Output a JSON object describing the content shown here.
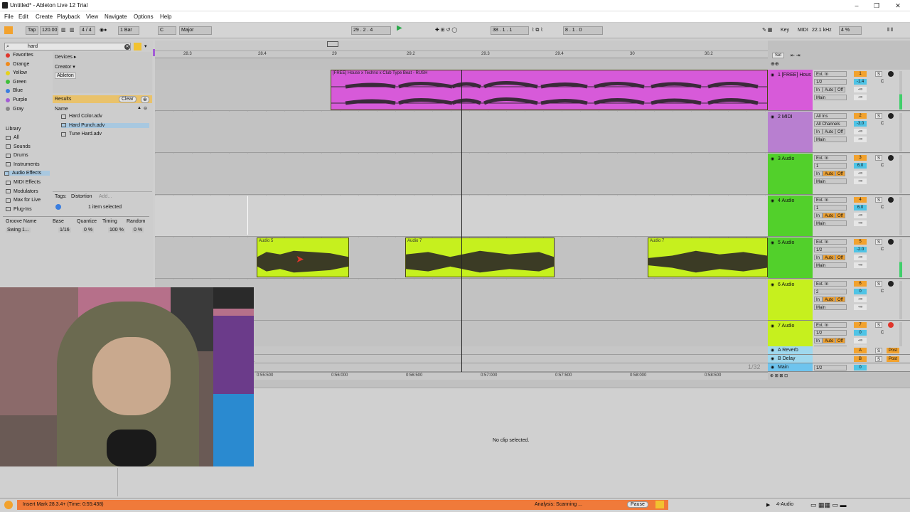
{
  "window": {
    "title": "Untitled* - Ableton Live 12 Trial"
  },
  "menu": [
    "File",
    "Edit",
    "Create",
    "Playback",
    "View",
    "Navigate",
    "Options",
    "Help"
  ],
  "control": {
    "tap": "Tap",
    "tempo": "120.00",
    "signature": "4 / 4",
    "quantize": "1 Bar",
    "key": "C",
    "scale": "Major",
    "position": "29 .  2 .  4",
    "loop_start": "38 .  1 .  1",
    "loop_length": "8 .  1 .  0",
    "key_label": "Key",
    "midi_label": "MIDI",
    "sample_rate": "22.1 kHz",
    "cpu": "4 %"
  },
  "browser": {
    "search": "hard",
    "collections": [
      {
        "label": "Favorites",
        "color": "#e0352b"
      },
      {
        "label": "Orange",
        "color": "#f08a1c"
      },
      {
        "label": "Yellow",
        "color": "#e6d21a"
      },
      {
        "label": "Green",
        "color": "#3fbf3a"
      },
      {
        "label": "Blue",
        "color": "#3a7ee0"
      },
      {
        "label": "Purple",
        "color": "#a35cd6"
      },
      {
        "label": "Gray",
        "color": "#888888"
      }
    ],
    "library_label": "Library",
    "library": [
      "All",
      "Sounds",
      "Drums",
      "Instruments",
      "Audio Effects",
      "MIDI Effects",
      "Modulators",
      "Max for Live",
      "Plug-Ins"
    ],
    "filters": {
      "devices": "Devices ▸",
      "creator": "Creator ▾",
      "ableton": "Ableton"
    },
    "results_label": "Results",
    "clear": "Clear",
    "name_header": "Name",
    "results": [
      "Hard Color.adv",
      "Hard Punch.adv",
      "Tune Hard.adv"
    ],
    "tags_label": "Tags:",
    "tag": "Distortion",
    "add": "Add...",
    "selection": "1 item selected"
  },
  "groove": {
    "headers": [
      "Groove Name",
      "Base",
      "Quantize",
      "Timing",
      "Random"
    ],
    "row": [
      "Swing 1...",
      "1/16",
      "0 %",
      "100 %",
      "0 %"
    ]
  },
  "ruler": {
    "bars": [
      "28.3",
      "28.4",
      "29",
      "29.2",
      "29.3",
      "29.4",
      "30",
      "30.2"
    ],
    "set": "Set"
  },
  "time_ruler": [
    "0:55:500",
    "0:56:000",
    "0:56:500",
    "0:57:000",
    "0:57:500",
    "0:58:000",
    "0:58:500"
  ],
  "zoom": "1/32",
  "clips": {
    "track1": "[FREE] House x Techno x Club Type Beat - RUSH",
    "a5": "Audio 5",
    "a7a": "Audio 7",
    "a7b": "Audio 7"
  },
  "tracks": [
    {
      "name": "1 [FREE] Hous",
      "num": "1",
      "in": "Ext. In",
      "ch": "1/2",
      "vol": "-1.4",
      "pan": "C",
      "out": "Main",
      "color": "#d75ad9",
      "numcolor": "#f2a22e"
    },
    {
      "name": "2 MIDI",
      "num": "2",
      "in": "All Ins",
      "ch": "All Channels",
      "vol": "-3.0",
      "pan": "C",
      "out": "Main",
      "color": "#b87fd0",
      "numcolor": "#f2a22e"
    },
    {
      "name": "3 Audio",
      "num": "3",
      "in": "Ext. In",
      "ch": "1",
      "vol": "6.0",
      "pan": "C",
      "out": "Main",
      "color": "#52d02b",
      "numcolor": "#f2a22e"
    },
    {
      "name": "4 Audio",
      "num": "4",
      "in": "Ext. In",
      "ch": "1",
      "vol": "6.0",
      "pan": "C",
      "out": "Main",
      "color": "#52d02b",
      "numcolor": "#f2a22e"
    },
    {
      "name": "5 Audio",
      "num": "5",
      "in": "Ext. In",
      "ch": "1/2",
      "vol": "-2.0",
      "pan": "C",
      "out": "Main",
      "color": "#52d02b",
      "numcolor": "#f2a22e"
    },
    {
      "name": "6 Audio",
      "num": "6",
      "in": "Ext. In",
      "ch": "2",
      "vol": "0",
      "pan": "C",
      "out": "Main",
      "color": "#c6f01e",
      "numcolor": "#f2a22e"
    },
    {
      "name": "7 Audio",
      "num": "7",
      "in": "Ext. In",
      "ch": "1/2",
      "vol": "0",
      "pan": "C",
      "out": "Main",
      "color": "#c6f01e",
      "numcolor": "#f2a22e"
    }
  ],
  "returns": [
    {
      "name": "A Reverb",
      "num": "A",
      "color": "#9fd8ee"
    },
    {
      "name": "B Delay",
      "num": "B",
      "color": "#9fd8ee"
    },
    {
      "name": "Main",
      "num": "0",
      "color": "#9fd8ee"
    }
  ],
  "mix_labels": {
    "in": "In",
    "auto": "Auto",
    "off": "Off",
    "inf": "-∞",
    "s": "S",
    "post": "Post",
    "main_ch": "1/2",
    "main_vol": "0"
  },
  "detail": {
    "message": "No clip selected."
  },
  "status": {
    "left": "Insert Mark 28.3.4+ (Time: 0:55:438)",
    "analysis": "Analysis: Scanning ...",
    "pause": "Pause",
    "track": "4-Audio"
  }
}
